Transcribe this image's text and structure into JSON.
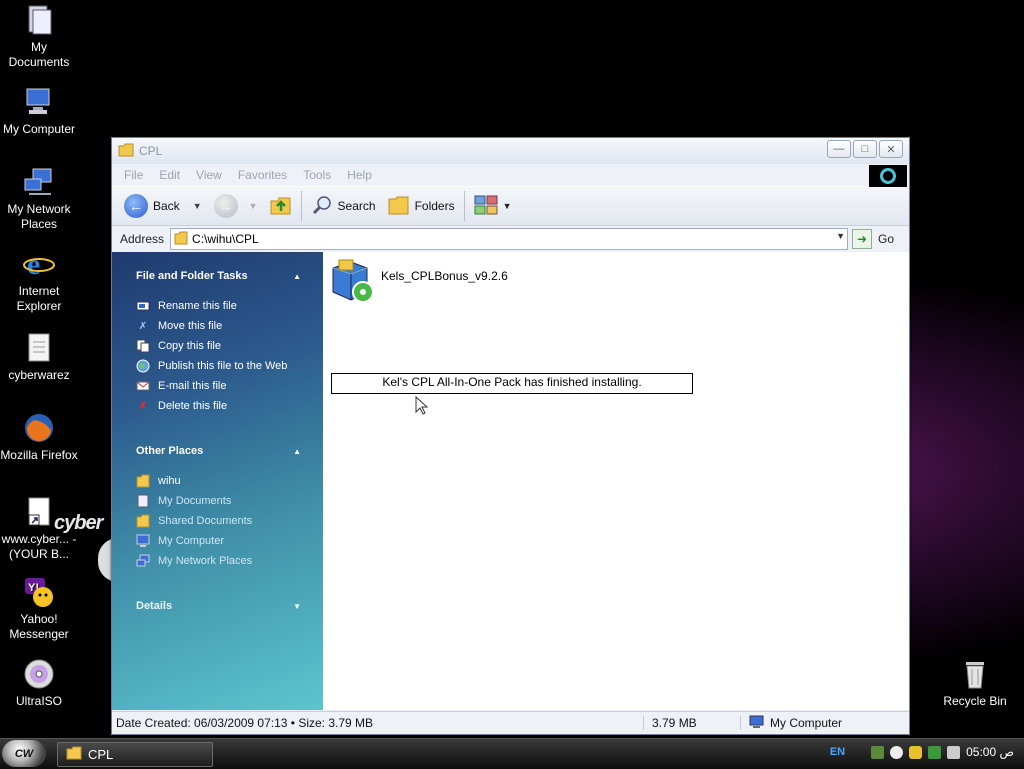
{
  "desktop": {
    "icons": [
      {
        "label": "My Documents"
      },
      {
        "label": "My Computer"
      },
      {
        "label": "My Network Places"
      },
      {
        "label": "Internet Explorer"
      },
      {
        "label": "cyberwarez"
      },
      {
        "label": "Mozilla Firefox"
      },
      {
        "label": "www.cyber... - (YOUR B..."
      },
      {
        "label": "Yahoo! Messenger"
      },
      {
        "label": "UltraISO"
      },
      {
        "label": "Recycle Bin"
      }
    ],
    "logo_text": "cyber"
  },
  "window": {
    "title": "CPL",
    "menu": [
      "File",
      "Edit",
      "View",
      "Favorites",
      "Tools",
      "Help"
    ],
    "toolbar": {
      "back": "Back",
      "search": "Search",
      "folders": "Folders"
    },
    "address": {
      "label": "Address",
      "value": "C:\\wihu\\CPL",
      "go": "Go"
    },
    "tasks": {
      "file_folder_tasks": {
        "title": "File and Folder Tasks",
        "items": [
          "Rename this file",
          "Move this file",
          "Copy this file",
          "Publish this file to the Web",
          "E-mail this file",
          "Delete this file"
        ]
      },
      "other_places": {
        "title": "Other Places",
        "items": [
          "wihu",
          "My Documents",
          "Shared Documents",
          "My Computer",
          "My Network Places"
        ]
      },
      "details": {
        "title": "Details"
      }
    },
    "files": [
      {
        "name": "Kels_CPLBonus_v9.2.6"
      }
    ],
    "message": "Kel's CPL All-In-One Pack has finished installing.",
    "status": {
      "info": "Date Created: 06/03/2009 07:13 • Size: 3.79 MB",
      "size": "3.79 MB",
      "location": "My Computer"
    }
  },
  "taskbar": {
    "start_label": "CW",
    "task": "CPL",
    "lang": "EN",
    "clock": "ص 05:00"
  }
}
